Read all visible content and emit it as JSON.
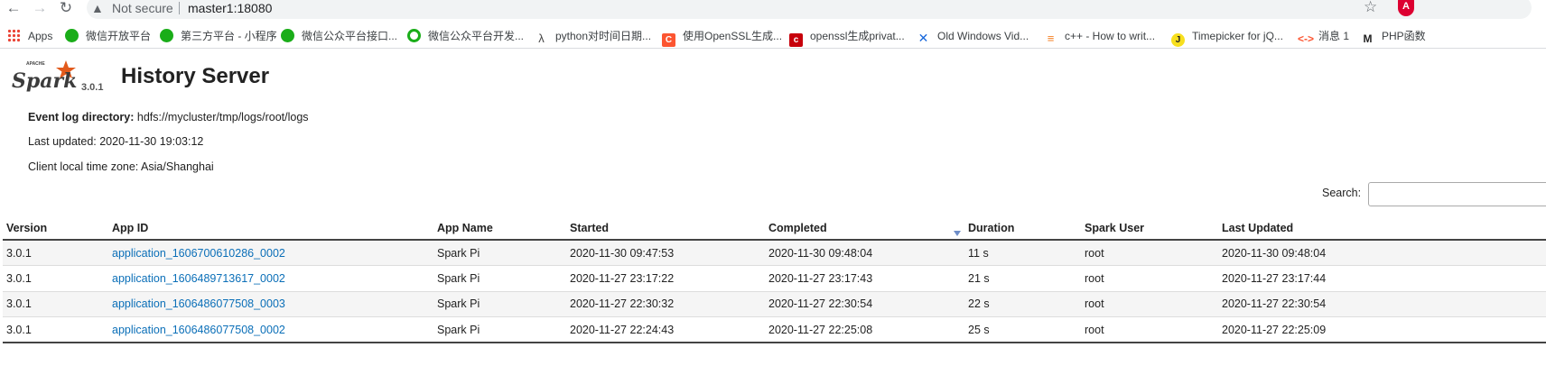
{
  "browser": {
    "security_label": "Not secure",
    "url": "master1:18080",
    "bookmarks": [
      {
        "label": "Apps",
        "icon": "apps-grid-icon"
      },
      {
        "label": "微信开放平台",
        "icon": "wechat-icon"
      },
      {
        "label": "第三方平台 - 小程序",
        "icon": "wechat-icon"
      },
      {
        "label": "微信公众平台接口...",
        "icon": "wechat-icon"
      },
      {
        "label": "微信公众平台开发...",
        "icon": "wechat-outline-icon"
      },
      {
        "label": "python对时间日期...",
        "icon": "python-icon"
      },
      {
        "label": "使用OpenSSL生成...",
        "icon": "csdn-icon"
      },
      {
        "label": "openssl生成privat...",
        "icon": "cnblogs-icon"
      },
      {
        "label": "Old Windows Vid...",
        "icon": "confluence-icon"
      },
      {
        "label": "c++ - How to writ...",
        "icon": "stackoverflow-icon"
      },
      {
        "label": "Timepicker for jQ...",
        "icon": "jquery-icon"
      },
      {
        "label": "消息 1",
        "icon": "message-icon"
      },
      {
        "label": "PHP函数",
        "icon": "php-icon"
      }
    ]
  },
  "header": {
    "version": "3.0.1",
    "title": "History Server"
  },
  "info": {
    "event_log_label": "Event log directory:",
    "event_log_value": "hdfs://mycluster/tmp/logs/root/logs",
    "last_updated": "Last updated: 2020-11-30 19:03:12",
    "timezone": "Client local time zone: Asia/Shanghai"
  },
  "search": {
    "label": "Search:",
    "value": ""
  },
  "table": {
    "columns": [
      "Version",
      "App ID",
      "App Name",
      "Started",
      "Completed",
      "Duration",
      "Spark User",
      "Last Updated"
    ],
    "sorted_column": "Completed",
    "rows": [
      {
        "version": "3.0.1",
        "app_id": "application_1606700610286_0002",
        "app_name": "Spark Pi",
        "started": "2020-11-30 09:47:53",
        "completed": "2020-11-30 09:48:04",
        "duration": "11 s",
        "user": "root",
        "last_updated": "2020-11-30 09:48:04"
      },
      {
        "version": "3.0.1",
        "app_id": "application_1606489713617_0002",
        "app_name": "Spark Pi",
        "started": "2020-11-27 23:17:22",
        "completed": "2020-11-27 23:17:43",
        "duration": "21 s",
        "user": "root",
        "last_updated": "2020-11-27 23:17:44"
      },
      {
        "version": "3.0.1",
        "app_id": "application_1606486077508_0003",
        "app_name": "Spark Pi",
        "started": "2020-11-27 22:30:32",
        "completed": "2020-11-27 22:30:54",
        "duration": "22 s",
        "user": "root",
        "last_updated": "2020-11-27 22:30:54"
      },
      {
        "version": "3.0.1",
        "app_id": "application_1606486077508_0002",
        "app_name": "Spark Pi",
        "started": "2020-11-27 22:24:43",
        "completed": "2020-11-27 22:25:08",
        "duration": "25 s",
        "user": "root",
        "last_updated": "2020-11-27 22:25:09"
      }
    ]
  }
}
